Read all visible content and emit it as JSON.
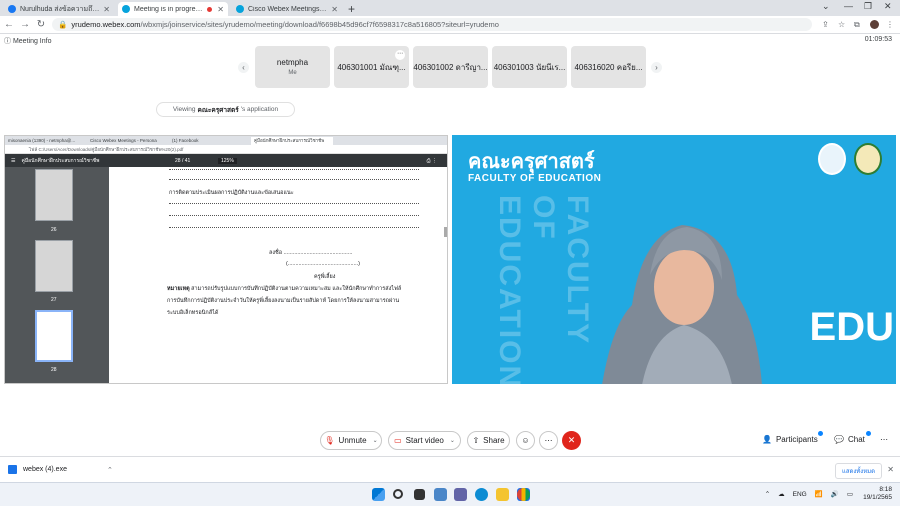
{
  "browser": {
    "tabs": [
      {
        "title": "Nurulhuda ส่งข้อความถึง ทดแล้วคาง",
        "active": false
      },
      {
        "title": "Meeting is in progress...",
        "active": true
      },
      {
        "title": "Cisco Webex Meetings - Persona",
        "active": false
      }
    ],
    "url_host": "yrudemo.webex.com",
    "url_path": "/wbxmjs/joinservice/sites/yrudemo/meeting/download/f6698b45d96cf7f6598317c8a516805?siteurl=yrudemo"
  },
  "meeting": {
    "info_label": "Meeting Info",
    "timer": "01:09:53",
    "participants": [
      {
        "name": "netmpha",
        "sub": "Me"
      },
      {
        "name": "406301001 มัณฑุ...",
        "sub": ""
      },
      {
        "name": "406301002 ดารีญา...",
        "sub": ""
      },
      {
        "name": "406301003 นัยนีเร...",
        "sub": ""
      },
      {
        "name": "406316020 คอรีย...",
        "sub": ""
      }
    ],
    "viewing_prefix": "Viewing",
    "viewing_name": "คณะครุศาสตร์",
    "viewing_suffix": "'s application"
  },
  "shared": {
    "tabs": [
      "misonaenia (1390) - netmpha@...",
      "Cisco Webex Meetings - Persona",
      "(1) Facebook",
      "คู่มือนักศึกษาฝึกประสบการณ์วิชาชีพ"
    ],
    "address": "ไฟล์   C:/Users/Acer/Downloads/คู่มือนักศึกษาฝึกประสบการณ์วิชาชีพ%20(2).pdf",
    "pdf_title": "คู่มือนักศึกษาฝึกประสบการณ์วิชาชีพ",
    "page_indicator": "28 / 41",
    "zoom": "125%",
    "thumb_pages": [
      "26",
      "27",
      "28"
    ],
    "lines": {
      "heading": "การติดตามประเมินผลการปฏิบัติงานและข้อเสนอแนะ",
      "sign": "ลงชื่อ .............................................",
      "sign_paren": "(..............................................)",
      "mentor": "ครูพี่เลี้ยง",
      "note_label": "หมายเหตุ",
      "note_1": " สามารถปรับรูปแบบการบันทึกปฏิบัติงานตามความเหมาะสม และให้นักศึกษาทำการส่งไฟล์",
      "note_2": "การบันทึกการปฏิบัติงานประจำวันให้ครูพี่เลี้ยงลงนามเป็นรายสัปดาห์ โดยการให้ลงนามสามารถผ่าน",
      "note_3": "ระบบอิเล็กทรอนิกส์ได้"
    }
  },
  "video": {
    "faculty_th": "คณะครุศาสตร์",
    "faculty_en": "FACULTY OF EDUCATION",
    "vertical_text": "FACULTY OF EDUCATION",
    "edu": "EDU"
  },
  "controls": {
    "unmute": "Unmute",
    "start_video": "Start video",
    "share": "Share",
    "participants": "Participants",
    "chat": "Chat"
  },
  "downloads": {
    "file": "webex (4).exe",
    "show_all": "แสดงทั้งหมด"
  },
  "taskbar": {
    "lang": "ENG",
    "time": "8:18",
    "date": "19/1/2565"
  },
  "colors": {
    "video_bg": "#21a9e1",
    "leave": "#e0251b",
    "accent": "#0a84ff"
  }
}
